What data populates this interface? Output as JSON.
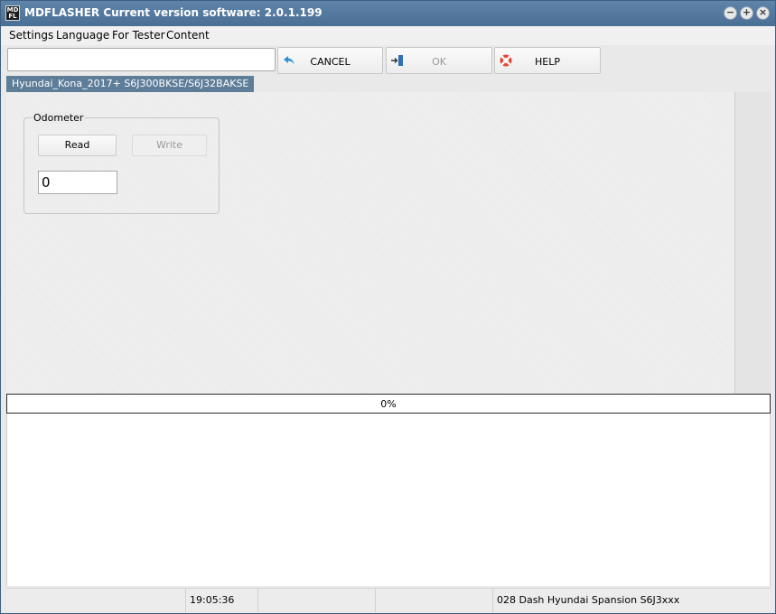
{
  "window": {
    "icon_text": "MD\nFL",
    "title": "MDFLASHER  Current version software: 2.0.1.199",
    "controls": {
      "minimize": "−",
      "maximize": "+",
      "close": "×"
    }
  },
  "menu": {
    "items": [
      {
        "label": "Settings"
      },
      {
        "label": "Language"
      },
      {
        "label": "For Tester"
      },
      {
        "label": "Content"
      }
    ]
  },
  "toolbar": {
    "path_value": "",
    "cancel_label": "CANCEL",
    "ok_label": "OK",
    "help_label": "HELP"
  },
  "tab": {
    "label": "Hyundai_Kona_2017+ S6J300BKSE/S6J32BAKSE"
  },
  "odometer": {
    "group_title": "Odometer",
    "read_label": "Read",
    "write_label": "Write",
    "value": "0"
  },
  "progress": {
    "value": 0,
    "text": "0%"
  },
  "statusbar": {
    "cells": [
      "",
      "19:05:36",
      "",
      "",
      "028 Dash Hyundai Spansion S6J3xxx"
    ]
  },
  "colors": {
    "titlebar": "#4a6f95",
    "tab": "#5e7d99",
    "cancel_icon": "#2e8fd6",
    "ok_icon": "#2e6fb5",
    "help_icon": "#e04a3a"
  }
}
